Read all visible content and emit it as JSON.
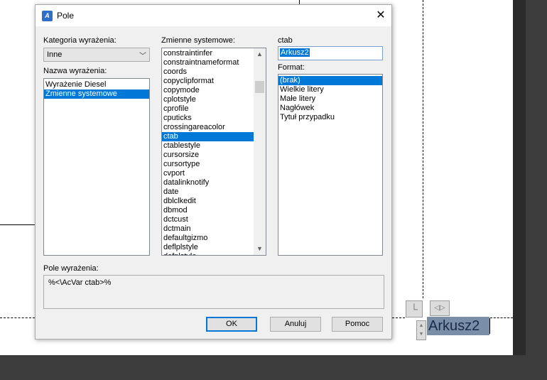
{
  "dialog": {
    "title": "Pole",
    "close_glyph": "✕",
    "category_label": "Kategoria wyrażenia:",
    "category_value": "Inne",
    "names_label": "Nazwa wyrażenia:",
    "names": [
      {
        "label": "Wyrażenie Diesel",
        "selected": false
      },
      {
        "label": "Zmienne systemowe",
        "selected": true
      }
    ],
    "sysvars_label": "Zmienne systemowe:",
    "sysvars": [
      {
        "label": "constraintinfer",
        "selected": false
      },
      {
        "label": "constraintnameformat",
        "selected": false
      },
      {
        "label": "coords",
        "selected": false
      },
      {
        "label": "copyclipformat",
        "selected": false
      },
      {
        "label": "copymode",
        "selected": false
      },
      {
        "label": "cplotstyle",
        "selected": false
      },
      {
        "label": "cprofile",
        "selected": false
      },
      {
        "label": "cputicks",
        "selected": false
      },
      {
        "label": "crossingareacolor",
        "selected": false
      },
      {
        "label": "ctab",
        "selected": true
      },
      {
        "label": "ctablestyle",
        "selected": false
      },
      {
        "label": "cursorsize",
        "selected": false
      },
      {
        "label": "cursortype",
        "selected": false
      },
      {
        "label": "cvport",
        "selected": false
      },
      {
        "label": "datalinknotify",
        "selected": false
      },
      {
        "label": "date",
        "selected": false
      },
      {
        "label": "dblclkedit",
        "selected": false
      },
      {
        "label": "dbmod",
        "selected": false
      },
      {
        "label": "dctcust",
        "selected": false
      },
      {
        "label": "dctmain",
        "selected": false
      },
      {
        "label": "defaultgizmo",
        "selected": false
      },
      {
        "label": "deflplstyle",
        "selected": false
      },
      {
        "label": "defplstyle",
        "selected": false
      }
    ],
    "preview_label": "ctab",
    "preview_value": "Arkusz2",
    "format_label": "Format:",
    "formats": [
      {
        "label": "(brak)",
        "selected": true
      },
      {
        "label": "Wielkie litery",
        "selected": false
      },
      {
        "label": "Małe litery",
        "selected": false
      },
      {
        "label": "Nagłówek",
        "selected": false
      },
      {
        "label": "Tytuł przypadku",
        "selected": false
      }
    ],
    "expression_label": "Pole wyrażenia:",
    "expression_value": "%<\\AcVar ctab>%",
    "buttons": {
      "ok": "OK",
      "cancel": "Anuluj",
      "help": "Pomoc"
    }
  },
  "cad": {
    "mtext_value": "Arkusz2",
    "grip_corner_glyph": "└",
    "grip_arrows_glyph": "◁▷",
    "grip_updown_glyph": "▲▼"
  },
  "colors": {
    "selection": "#0078d7",
    "mtext_highlight": "#7b8ea8"
  }
}
